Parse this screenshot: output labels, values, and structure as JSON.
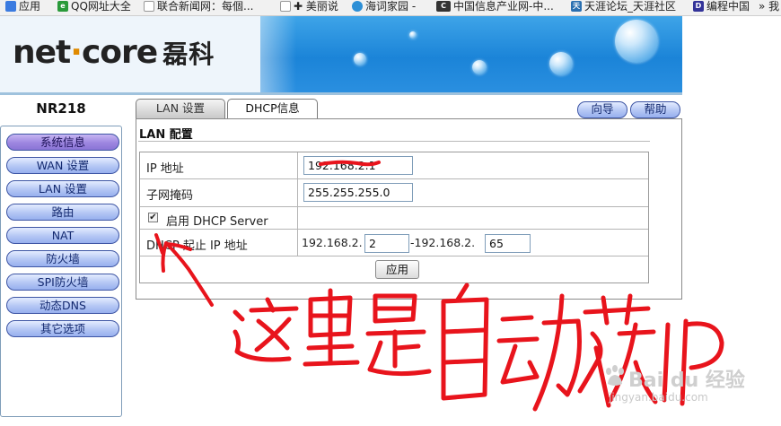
{
  "bookmarks": [
    {
      "label": "应用",
      "color": "#3b7be0"
    },
    {
      "label": "QQ网址大全",
      "color": "#2a9a3a"
    },
    {
      "label": "联合新闻网：每個...",
      "color": "#777777"
    },
    {
      "label": "✚ 美丽说",
      "color": "#777777"
    },
    {
      "label": "海词家园 -",
      "color": "#2d8fd6"
    },
    {
      "label": "中国信息产业网-中...",
      "color": "#333333"
    },
    {
      "label": "天涯论坛_天涯社区",
      "color": "#2a6fb0"
    },
    {
      "label": "编程中国",
      "color": "#333399"
    },
    {
      "label": "»  我",
      "color": "#555555"
    }
  ],
  "header": {
    "logo_main": "net",
    "logo_dot": "·",
    "logo_tail": "core",
    "logo_cn": "磊科",
    "model": "NR218"
  },
  "nav": {
    "items": [
      {
        "label": "系统信息",
        "active": true
      },
      {
        "label": "WAN 设置",
        "active": false
      },
      {
        "label": "LAN 设置",
        "active": false
      },
      {
        "label": "路由",
        "active": false
      },
      {
        "label": "NAT",
        "active": false
      },
      {
        "label": "防火墙",
        "active": false
      },
      {
        "label": "SPI防火墙",
        "active": false
      },
      {
        "label": "动态DNS",
        "active": false
      },
      {
        "label": "其它选项",
        "active": false
      }
    ]
  },
  "tabs": {
    "lan": "LAN 设置",
    "dhcp": "DHCP信息"
  },
  "top_buttons": {
    "wizard": "向导",
    "help": "帮助"
  },
  "section": {
    "title": "LAN 配置"
  },
  "form": {
    "ip_label": "IP    地址",
    "ip_value": "192.168.2.1",
    "mask_label": "子网掩码",
    "mask_value": "255.255.255.0",
    "dhcp_label": "启用 DHCP Server",
    "dhcp_checked": "✔",
    "range_label": "DHCP 起止 IP 地址",
    "range_prefix1": "192.168.2.",
    "range_start": "2",
    "range_prefix2": "-192.168.2.",
    "range_end": "65",
    "apply": "应用"
  },
  "annotation": {
    "text": "这里是自动获IP",
    "color": "#e8141c"
  },
  "watermark": {
    "brand": "Bai du 经验",
    "url": "jingyan.baidu.com"
  }
}
